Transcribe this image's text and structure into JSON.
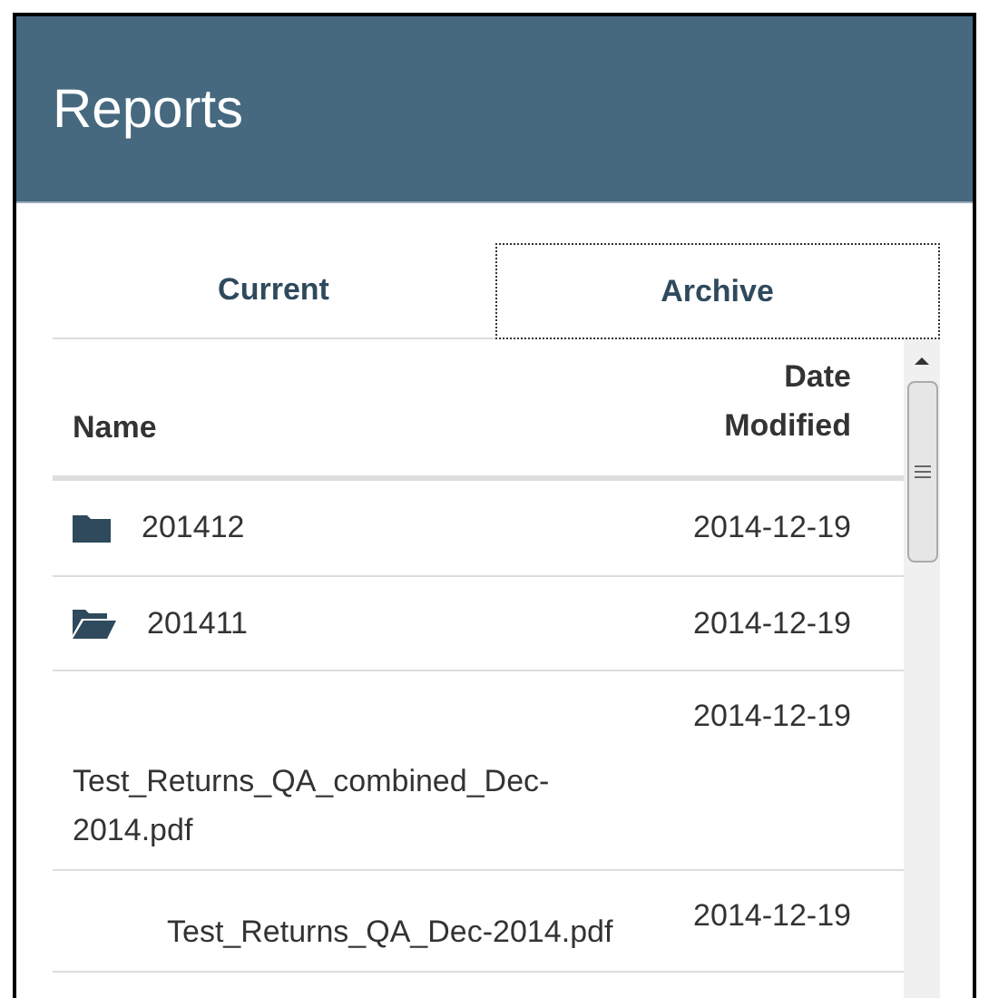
{
  "panel": {
    "title": "Reports"
  },
  "tabs": [
    {
      "label": "Current",
      "selected": false
    },
    {
      "label": "Archive",
      "selected": true
    }
  ],
  "table": {
    "columns": [
      "Name",
      "Date Modified"
    ],
    "rows": [
      {
        "kind": "folder",
        "name": "201412",
        "date": "2014-12-19"
      },
      {
        "kind": "folder-open",
        "name": "201411",
        "date": "2014-12-19"
      },
      {
        "kind": "file",
        "name": "Test_Returns_QA_combined_Dec-2014.pdf",
        "date": "2014-12-19"
      },
      {
        "kind": "file",
        "name": "Test_Returns_QA_Dec-2014.pdf",
        "date": "2014-12-19"
      }
    ]
  }
}
